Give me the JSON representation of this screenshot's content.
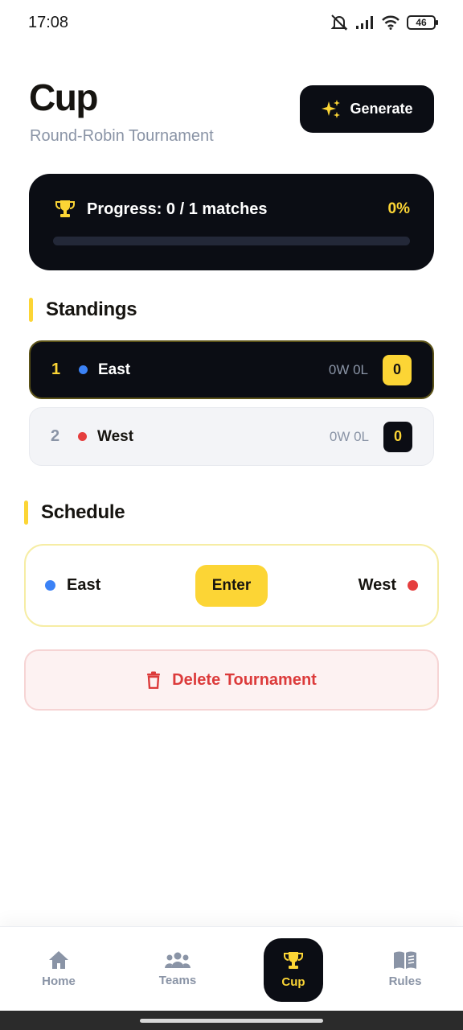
{
  "status_bar": {
    "time": "17:08",
    "battery": "46"
  },
  "header": {
    "title": "Cup",
    "subtitle": "Round-Robin Tournament",
    "generate_label": "Generate"
  },
  "progress": {
    "text": "Progress: 0 / 1 matches",
    "percent_label": "0%",
    "value": 0
  },
  "standings": {
    "title": "Standings",
    "rows": [
      {
        "rank": "1",
        "team": "East",
        "record": "0W 0L",
        "points": "0",
        "dot_color": "#3b82f6"
      },
      {
        "rank": "2",
        "team": "West",
        "record": "0W 0L",
        "points": "0",
        "dot_color": "#e53e3e"
      }
    ]
  },
  "schedule": {
    "title": "Schedule",
    "matches": [
      {
        "home": "East",
        "away": "West",
        "action_label": "Enter",
        "home_color": "#3b82f6",
        "away_color": "#e53e3e"
      }
    ]
  },
  "delete_label": "Delete Tournament",
  "nav": {
    "items": [
      {
        "label": "Home",
        "icon": "home-icon"
      },
      {
        "label": "Teams",
        "icon": "teams-icon"
      },
      {
        "label": "Cup",
        "icon": "trophy-icon"
      },
      {
        "label": "Rules",
        "icon": "book-icon"
      }
    ]
  },
  "colors": {
    "accent": "#fcd535",
    "dark": "#0b0d14",
    "danger": "#dc3b3b"
  }
}
